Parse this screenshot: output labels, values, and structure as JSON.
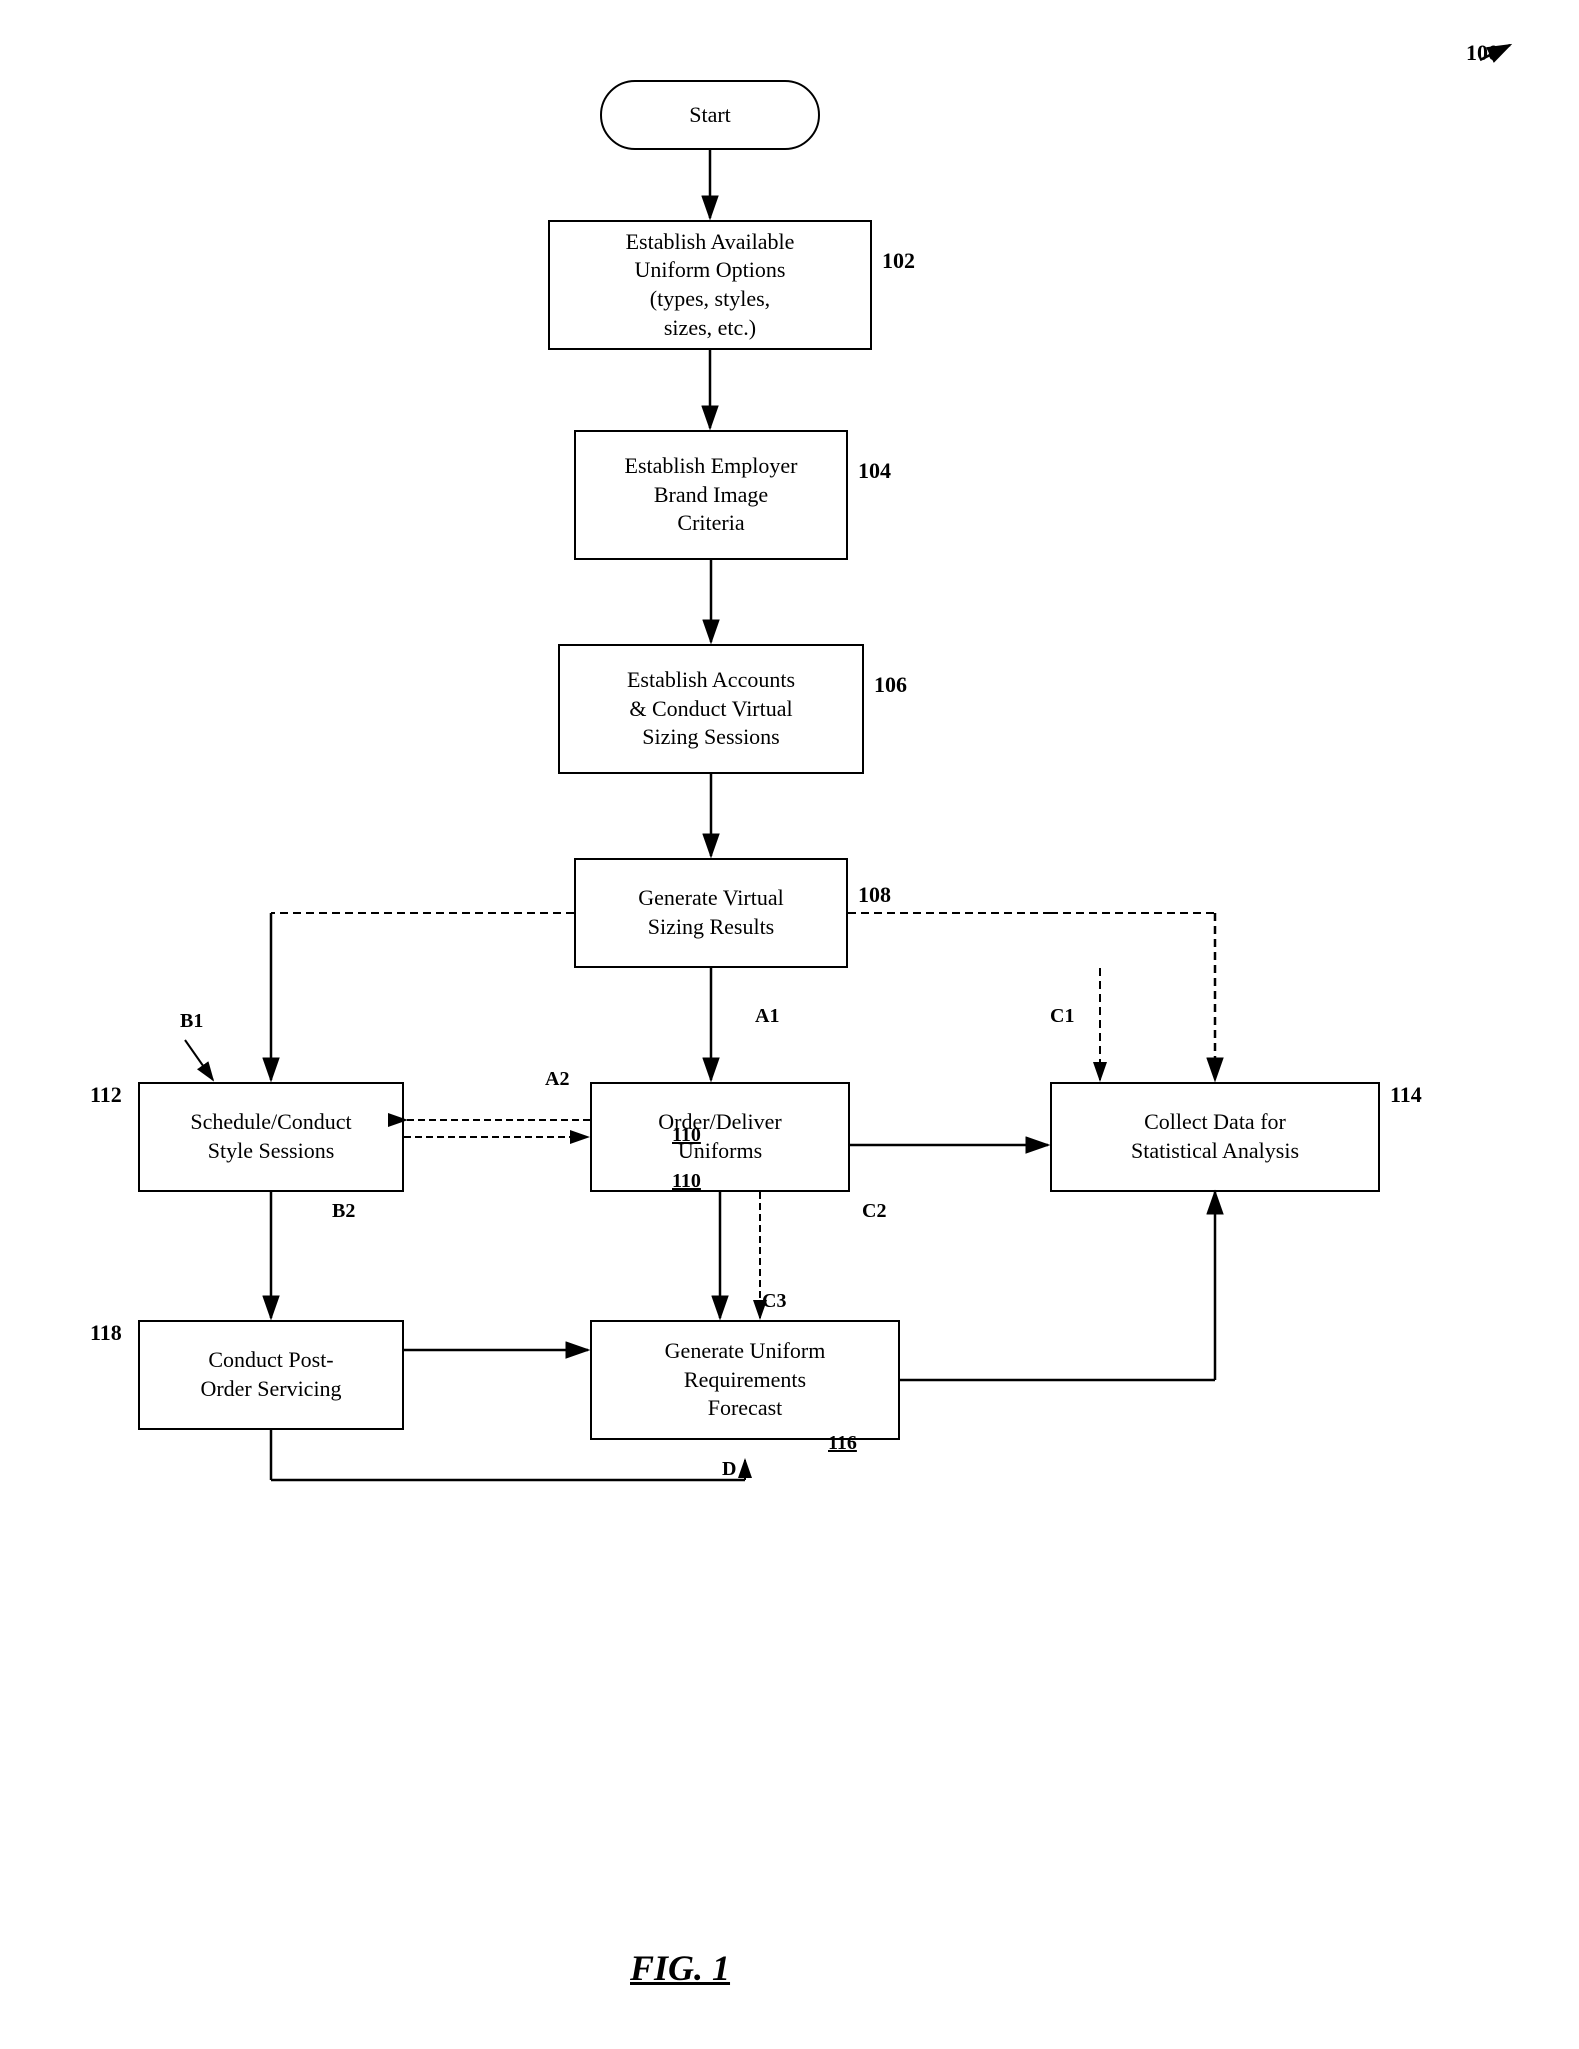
{
  "diagram": {
    "ref_main": "100",
    "fig_label": "FIG. 1",
    "nodes": {
      "start": {
        "label": "Start"
      },
      "n102": {
        "label": "Establish Available\nUniform Options\n(types, styles,\nsizes, etc.)",
        "ref": "102"
      },
      "n104": {
        "label": "Establish Employer\nBrand Image\nCriteria",
        "ref": "104"
      },
      "n106": {
        "label": "Establish Accounts\n& Conduct Virtual\nSizing Sessions",
        "ref": "106"
      },
      "n108": {
        "label": "Generate Virtual\nSizing Results",
        "ref": "108"
      },
      "n110": {
        "label": "Order/Deliver\nUniforms",
        "ref": "110"
      },
      "n112": {
        "label": "Schedule/Conduct\nStyle Sessions",
        "ref": "112"
      },
      "n114": {
        "label": "Collect Data for\nStatistical Analysis",
        "ref": "114"
      },
      "n116": {
        "label": "Generate Uniform\nRequirements\nForecast",
        "ref": "116"
      },
      "n118": {
        "label": "Conduct Post-\nOrder Servicing",
        "ref": "118"
      }
    },
    "connector_labels": {
      "A1": "A1",
      "A2": "A2",
      "B1": "B1",
      "B2": "B2",
      "C1": "C1",
      "C2": "C2",
      "C3": "C3",
      "D": "D"
    }
  }
}
